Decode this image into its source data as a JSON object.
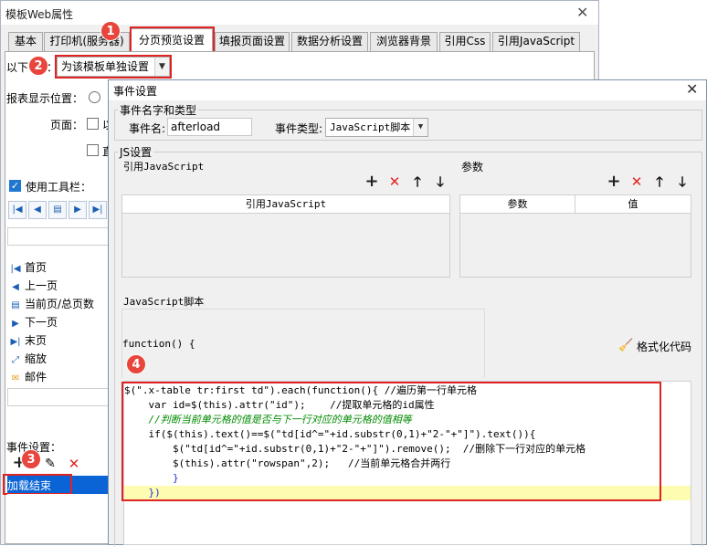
{
  "outer_window": {
    "title": "模板Web属性",
    "close": "✕",
    "tabs": [
      {
        "label": "基本"
      },
      {
        "label": "打印机(服务器)"
      },
      {
        "label": "分页预览设置"
      },
      {
        "label": "填报页面设置"
      },
      {
        "label": "数据分析设置"
      },
      {
        "label": "浏览器背景"
      },
      {
        "label": "引用Css"
      },
      {
        "label": "引用JavaScript"
      }
    ],
    "active_tab": "分页预览设置",
    "scope_prefix": "以下",
    "scope_suffix": "：",
    "scope_value": "为该模板单独设置",
    "report_position_label": "报表显示位置：",
    "page_label": "页面：",
    "page_option_1": "以",
    "page_option_2": "直",
    "use_toolbar_label": "使用工具栏：",
    "toolbar_items": [
      {
        "label": "首页",
        "icon": "first-page-icon"
      },
      {
        "label": "上一页",
        "icon": "prev-page-icon"
      },
      {
        "label": "当前页/总页数",
        "icon": "page-count-icon"
      },
      {
        "label": "下一页",
        "icon": "next-page-icon"
      },
      {
        "label": "末页",
        "icon": "last-page-icon"
      },
      {
        "label": "缩放",
        "icon": "zoom-icon"
      },
      {
        "label": "邮件",
        "icon": "mail-icon"
      }
    ],
    "event_settings_label": "事件设置：",
    "event_item": "加载结束"
  },
  "badges": [
    "1",
    "2",
    "3",
    "4"
  ],
  "dialog": {
    "title": "事件设置",
    "close": "✕",
    "name_group_title": "事件名字和类型",
    "event_name_label": "事件名:",
    "event_name_value": "afterload",
    "event_type_label": "事件类型:",
    "event_type_value": "JavaScript脚本",
    "js_group_title": "JS设置",
    "ref_js_title": "引用JavaScript",
    "ref_js_col": "引用JavaScript",
    "params_title": "参数",
    "param_col_name": "参数",
    "param_col_value": "值",
    "script_title": "JavaScript脚本",
    "function_header": "function() {",
    "format_code_label": "格式化代码",
    "code_lines": [
      "$(\".x-table tr:first td\").each(function(){ //遍历第一行单元格",
      "    var id=$(this).attr(\"id\");    //提取单元格的id属性",
      "    //判断当前单元格的值是否与下一行对应的单元格的值相等",
      "    if($(this).text()==$(\"td[id^=\"+id.substr(0,1)+\"2-\"+\"]\").text()){",
      "        $(\"td[id^=\"+id.substr(0,1)+\"2-\"+\"]\").remove();  //删除下一行对应的单元格",
      "        $(this).attr(\"rowspan\",2);   //当前单元格合并两行",
      "        }",
      "    })"
    ]
  },
  "colors": {
    "accent_red": "#e02424",
    "badge_red": "#e8453c",
    "selection_blue": "#0a64d6",
    "highlight_yellow": "#fdfcb0"
  }
}
